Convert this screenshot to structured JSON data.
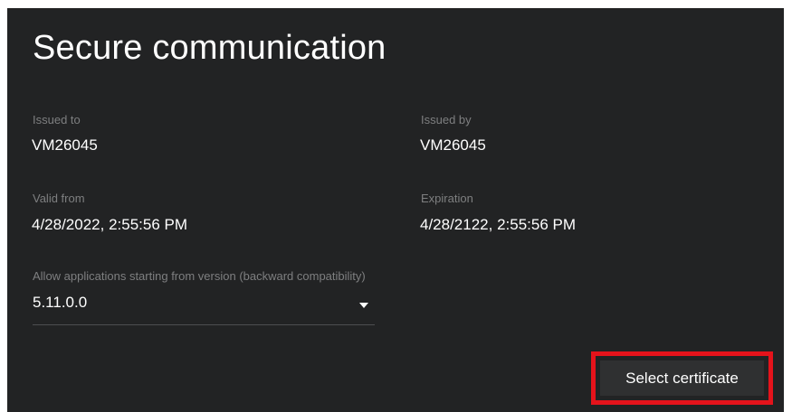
{
  "page": {
    "title": "Secure communication"
  },
  "certificate": {
    "issued_to_label": "Issued to",
    "issued_to_value": "VM26045",
    "issued_by_label": "Issued by",
    "issued_by_value": "VM26045",
    "valid_from_label": "Valid from",
    "valid_from_value": "4/28/2022, 2:55:56 PM",
    "expiration_label": "Expiration",
    "expiration_value": "4/28/2122, 2:55:56 PM"
  },
  "compatibility": {
    "label": "Allow applications starting from version (backward compatibility)",
    "selected_value": "5.11.0.0"
  },
  "actions": {
    "select_certificate_label": "Select certificate"
  },
  "icons": {
    "dropdown": "chevron-down-icon"
  },
  "colors": {
    "panel_background": "#222324",
    "label_text": "#7e7f80",
    "value_text": "#ffffff",
    "highlight_border": "#e5131b"
  }
}
